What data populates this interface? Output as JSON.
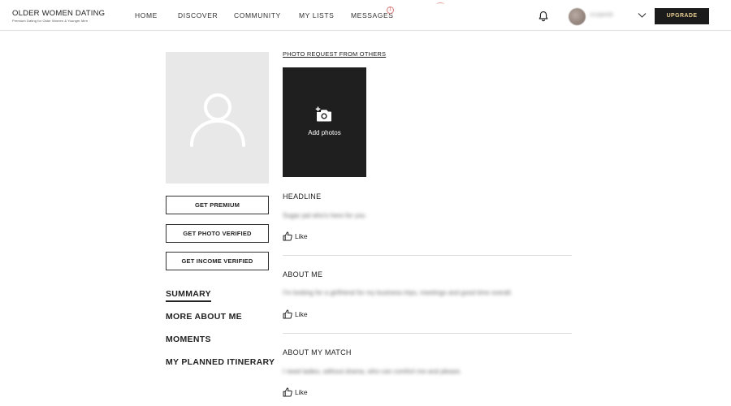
{
  "brand": {
    "name": "OLDER WOMEN DATING",
    "tagline": "Premium Dating for Older Women & Younger Men"
  },
  "nav": {
    "home": "HOME",
    "discover": "DISCOVER",
    "community": "COMMUNITY",
    "my_lists": "MY LISTS",
    "messages": "MESSAGES",
    "messages_badge": "1"
  },
  "user": {
    "username": "sruqaede"
  },
  "header": {
    "upgrade_label": "UPGRADE"
  },
  "left": {
    "buttons": {
      "premium": "GET PREMIUM",
      "photo_verified": "GET PHOTO VERIFIED",
      "income_verified": "GET INCOME VERIFIED"
    },
    "menu": {
      "summary": "SUMMARY",
      "more_about_me": "MORE ABOUT ME",
      "moments": "MOMENTS",
      "itinerary": "MY PLANNED ITINERARY"
    }
  },
  "main": {
    "photo_request_label": "PHOTO REQUEST FROM OTHERS",
    "add_photos_label": "Add photos",
    "sections": [
      {
        "title": "HEADLINE",
        "text": "Sugar pal who's here for you",
        "like": "Like"
      },
      {
        "title": "ABOUT ME",
        "text": "I'm looking for a girlfriend for my business trips, meetings and good time overall.",
        "like": "Like"
      },
      {
        "title": "ABOUT MY MATCH",
        "text": "I need ladies, without drama, who can comfort me and please.",
        "like": "Like"
      }
    ]
  },
  "colors": {
    "upgrade_bg": "#1b1b1b",
    "upgrade_text": "#e6cc8f",
    "add_photos_bg": "#1f1f1f",
    "photo_placeholder_bg": "#e8e8e8"
  },
  "icons": {
    "bell": "bell-icon",
    "chevron": "chevron-down-icon",
    "camera_add": "camera-add-icon",
    "thumbs_up": "thumbs-up-icon",
    "user_silhouette": "user-silhouette-icon"
  }
}
